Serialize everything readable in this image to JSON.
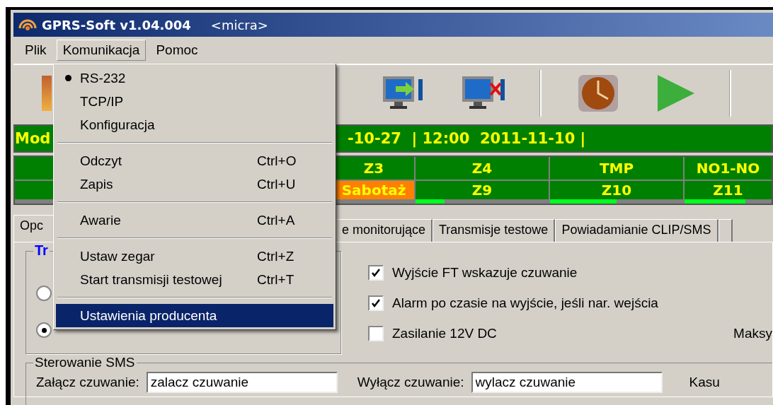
{
  "window": {
    "title": "GPRS-Soft v1.04.004",
    "subtitle": "<micra>"
  },
  "menubar": [
    {
      "label": "Plik",
      "selected": false
    },
    {
      "label": "Komunikacja",
      "selected": true
    },
    {
      "label": "Pomoc",
      "selected": false
    }
  ],
  "menu": {
    "items": [
      {
        "kind": "item",
        "label": "RS-232",
        "checked": true,
        "selected": false
      },
      {
        "kind": "item",
        "label": "TCP/IP",
        "checked": false,
        "selected": false
      },
      {
        "kind": "item",
        "label": "Konfiguracja",
        "checked": false,
        "selected": false
      },
      {
        "kind": "separator"
      },
      {
        "kind": "item",
        "label": "Odczyt",
        "shortcut": "Ctrl+O",
        "checked": false,
        "selected": false
      },
      {
        "kind": "item",
        "label": "Zapis",
        "shortcut": "Ctrl+U",
        "checked": false,
        "selected": false
      },
      {
        "kind": "separator"
      },
      {
        "kind": "item",
        "label": "Awarie",
        "shortcut": "Ctrl+A",
        "checked": false,
        "selected": false
      },
      {
        "kind": "separator"
      },
      {
        "kind": "item",
        "label": "Ustaw zegar",
        "shortcut": "Ctrl+Z",
        "checked": false,
        "selected": false
      },
      {
        "kind": "item",
        "label": "Start transmisji testowej",
        "shortcut": "Ctrl+T",
        "checked": false,
        "selected": false
      },
      {
        "kind": "separator"
      },
      {
        "kind": "item",
        "label": "Ustawienia producenta",
        "checked": false,
        "selected": true
      }
    ]
  },
  "status_bar": {
    "left": "Mod",
    "right": "-10-27  | 12:00  2011-11-10 |"
  },
  "zones": {
    "row_1": [
      {
        "label": "Z3",
        "kind": "normal"
      },
      {
        "label": "Z4",
        "kind": "normal"
      },
      {
        "label": "TMP",
        "kind": "normal"
      },
      {
        "label": "NO1-NO",
        "kind": "normal"
      }
    ],
    "row_2": [
      {
        "label": "Sabotaż",
        "kind": "alarm"
      },
      {
        "label": "Z9",
        "kind": "normal",
        "level": 0.22
      },
      {
        "label": "Z10",
        "kind": "normal",
        "level": 0.5
      },
      {
        "label": "Z11",
        "kind": "normal",
        "level": 0.7
      }
    ]
  },
  "tabs": [
    {
      "label": "Opc",
      "selected": true
    },
    {
      "label": "e monitorujące",
      "selected": false
    },
    {
      "label": "Transmisje testowe",
      "selected": false
    },
    {
      "label": "Powiadamianie CLIP/SMS",
      "selected": false
    }
  ],
  "group": {
    "title": "Tr",
    "radios": [
      {
        "selected": false
      },
      {
        "selected": true
      }
    ]
  },
  "options": [
    {
      "label": "Wyjście FT wskazuje czuwanie",
      "checked": true
    },
    {
      "label": "Alarm po czasie na wyjście, jeśli nar. wejścia",
      "checked": true
    },
    {
      "label": "Zasilanie 12V DC",
      "checked": false
    }
  ],
  "right_label": "Maksy",
  "sms": {
    "title": "Sterowanie SMS",
    "fields": [
      {
        "label": "Załącz czuwanie:",
        "value": "zalacz czuwanie"
      },
      {
        "label": "Wyłącz czuwanie:",
        "value": "wylacz czuwanie"
      }
    ],
    "trailing": "Kasu"
  }
}
